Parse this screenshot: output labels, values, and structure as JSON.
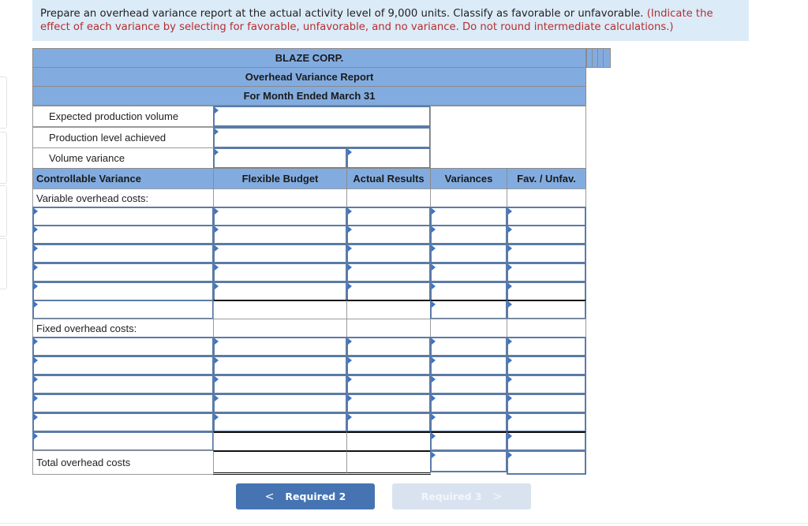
{
  "instructions": {
    "main": "Prepare an overhead variance report at the actual activity level of 9,000 units. Classify as favorable or unfavorable.",
    "note": "(Indicate the effect of each variance by selecting for favorable, unfavorable, and no variance. Do not round intermediate calculations.)"
  },
  "report": {
    "company": "BLAZE CORP.",
    "title": "Overhead Variance Report",
    "period": "For Month Ended March 31"
  },
  "volume_section": {
    "rows": [
      {
        "label": "Expected production volume",
        "value": ""
      },
      {
        "label": "Production level achieved",
        "value": ""
      },
      {
        "label": "Volume variance",
        "value": "",
        "value2": ""
      }
    ]
  },
  "columns": {
    "section": "Controllable Variance",
    "flexible_budget": "Flexible Budget",
    "actual_results": "Actual Results",
    "variances": "Variances",
    "fav_unfav": "Fav. / Unfav."
  },
  "variable": {
    "label": "Variable overhead costs:",
    "rows": [
      {
        "item": "",
        "flexible": "",
        "actual": "",
        "variance": "",
        "fav": ""
      },
      {
        "item": "",
        "flexible": "",
        "actual": "",
        "variance": "",
        "fav": ""
      },
      {
        "item": "",
        "flexible": "",
        "actual": "",
        "variance": "",
        "fav": ""
      },
      {
        "item": "",
        "flexible": "",
        "actual": "",
        "variance": "",
        "fav": ""
      },
      {
        "item": "",
        "flexible": "",
        "actual": "",
        "variance": "",
        "fav": ""
      }
    ],
    "subtotal": {
      "item": "",
      "variance": "",
      "fav": ""
    }
  },
  "fixed": {
    "label": "Fixed overhead costs:",
    "rows": [
      {
        "item": "",
        "flexible": "",
        "actual": "",
        "variance": "",
        "fav": ""
      },
      {
        "item": "",
        "flexible": "",
        "actual": "",
        "variance": "",
        "fav": ""
      },
      {
        "item": "",
        "flexible": "",
        "actual": "",
        "variance": "",
        "fav": ""
      },
      {
        "item": "",
        "flexible": "",
        "actual": "",
        "variance": "",
        "fav": ""
      },
      {
        "item": "",
        "flexible": "",
        "actual": "",
        "variance": "",
        "fav": ""
      }
    ],
    "subtotal": {
      "item": "",
      "variance": "",
      "fav": ""
    }
  },
  "total": {
    "label": "Total overhead costs",
    "variance": "",
    "fav": ""
  },
  "nav": {
    "prev_label": "Required 2",
    "next_label": "Required 3",
    "prev_icon": "chevron-left-icon",
    "next_icon": "chevron-right-icon"
  }
}
